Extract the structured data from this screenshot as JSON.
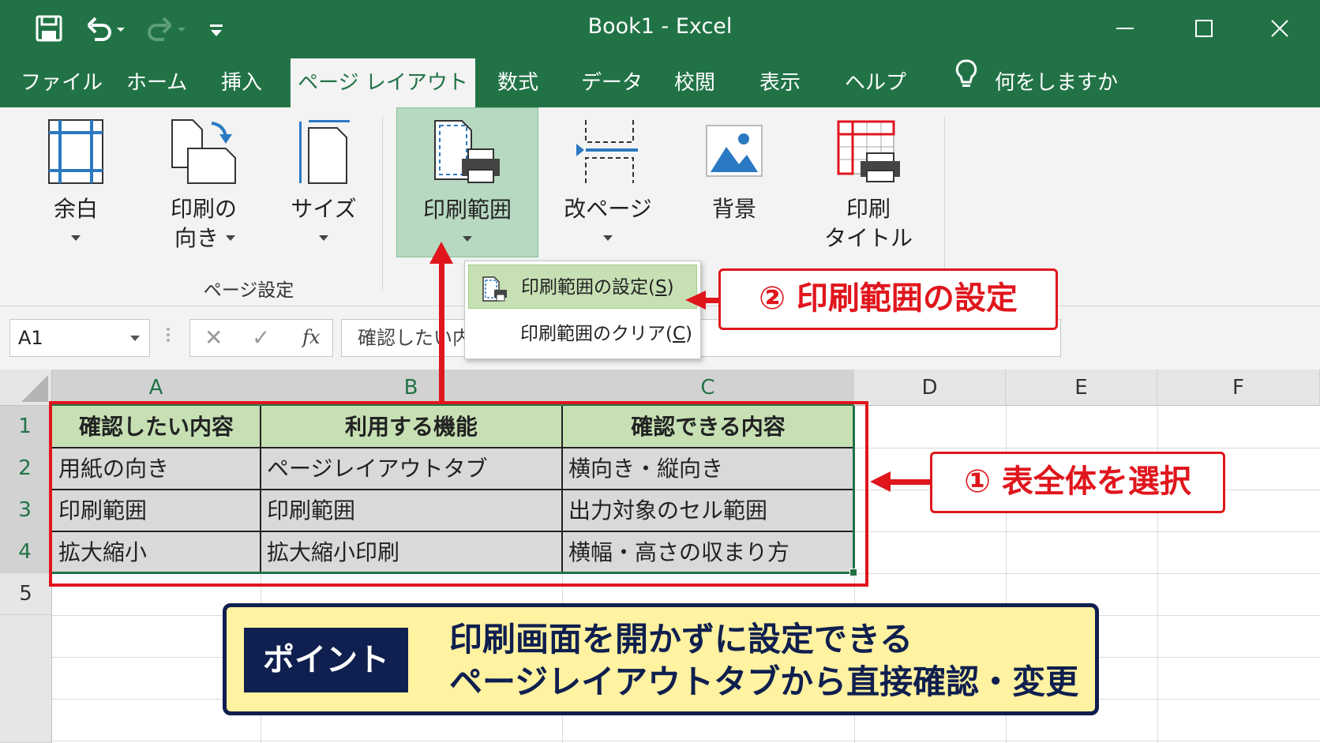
{
  "window": {
    "title": "Book1  -  Excel"
  },
  "tabs": [
    {
      "label": "ファイル"
    },
    {
      "label": "ホーム"
    },
    {
      "label": "挿入"
    },
    {
      "label": "ページ レイアウト",
      "active": true
    },
    {
      "label": "数式"
    },
    {
      "label": "データ"
    },
    {
      "label": "校閲"
    },
    {
      "label": "表示"
    },
    {
      "label": "ヘルプ"
    }
  ],
  "tell_me": {
    "icon": "lightbulb-icon",
    "label": "何をしますか"
  },
  "ribbon": {
    "margins": {
      "line1": "余白"
    },
    "orientation": {
      "line1": "印刷の",
      "line2": "向き"
    },
    "size": {
      "line1": "サイズ"
    },
    "print_area": {
      "line1": "印刷範囲"
    },
    "breaks": {
      "line1": "改ページ"
    },
    "background": {
      "line1": "背景"
    },
    "print_titles": {
      "line1": "印刷",
      "line2": "タイトル"
    },
    "group_label": "ページ設定"
  },
  "dropdown": {
    "set_item": {
      "label": "印刷範囲の設定(",
      "key": "S",
      "suffix": ")"
    },
    "clear_item": {
      "label": "印刷範囲のクリア(",
      "key": "C",
      "suffix": ")"
    }
  },
  "formula_bar": {
    "name_box": "A1",
    "cancel_glyph": "✕",
    "enter_glyph": "✓",
    "fx_label": "fx",
    "content": "確認したい内容"
  },
  "grid": {
    "columns": [
      "A",
      "B",
      "C",
      "D",
      "E",
      "F"
    ],
    "rows": [
      "1",
      "2",
      "3",
      "4",
      "5"
    ],
    "table": {
      "header": [
        "確認したい内容",
        "利用する機能",
        "確認できる内容"
      ],
      "body": [
        [
          "用紙の向き",
          "ページレイアウトタブ",
          "横向き・縦向き"
        ],
        [
          "印刷範囲",
          "印刷範囲",
          "出力対象のセル範囲"
        ],
        [
          "拡大縮小",
          "拡大縮小印刷",
          "横幅・高さの収まり方"
        ]
      ]
    }
  },
  "annotations": {
    "step1": "① 表全体を選択",
    "step2": "② 印刷範囲の設定",
    "point_badge": "ポイント",
    "point_line1": "印刷画面を開かずに設定できる",
    "point_line2": "ページレイアウトタブから直接確認・変更"
  },
  "colors": {
    "excel_green": "#217346",
    "highlight_green": "#c6e0b4",
    "annotation_red": "#e0161d",
    "point_navy": "#0f1f4f",
    "point_yellow": "#fff2a0"
  }
}
